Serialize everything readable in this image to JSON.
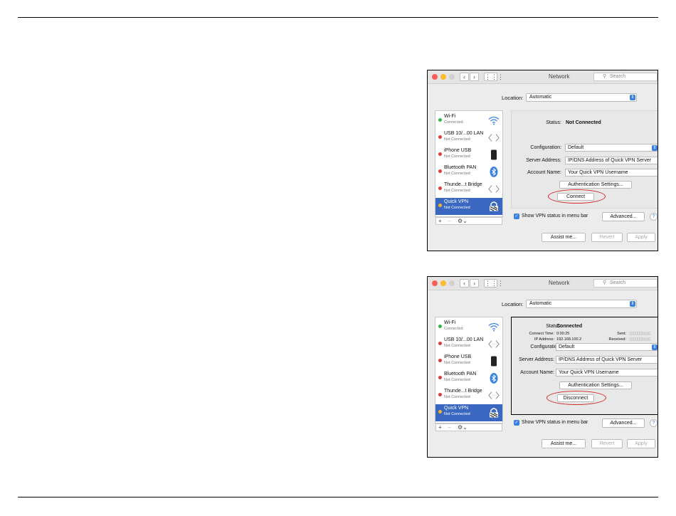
{
  "window_title": "Network",
  "search_placeholder": "Search",
  "location_label": "Location:",
  "location_value": "Automatic",
  "services": [
    {
      "name": "Wi-Fi",
      "status": "Connected",
      "dot": "#39b54a",
      "icon": "wifi-icon"
    },
    {
      "name": "USB 10/...00 LAN",
      "status": "Not Connected",
      "dot": "#e03b3b",
      "icon": "ethernet-icon"
    },
    {
      "name": "iPhone USB",
      "status": "Not Connected",
      "dot": "#e03b3b",
      "icon": "iphone-icon"
    },
    {
      "name": "Bluetooth PAN",
      "status": "Not Connected",
      "dot": "#e03b3b",
      "icon": "bluetooth-icon"
    },
    {
      "name": "Thunde...t Bridge",
      "status": "Not Connected",
      "dot": "#e03b3b",
      "icon": "bridge-icon"
    },
    {
      "name": "Quick VPN",
      "status": "Not Connected",
      "dot": "#f0b429",
      "icon": "vpn-lock-icon"
    }
  ],
  "sidebar_footer": {
    "add": "+",
    "remove": "−",
    "action": "⚙⌄"
  },
  "labels": {
    "status": "Status:",
    "connect_time": "Connect Time:",
    "ip_address": "IP Address:",
    "sent": "Sent:",
    "received": "Received:",
    "configuration": "Configuration:",
    "server_address": "Server Address:",
    "account_name": "Account Name:"
  },
  "values": {
    "configuration": "Default",
    "server_address": "IP/DNS Address of Quick VPN Server",
    "account_name": "Your Quick VPN Username"
  },
  "auth_button": "Authentication Settings...",
  "show_vpn_status": "Show VPN status in menu bar",
  "advanced_button": "Advanced...",
  "help": "?",
  "assist_button": "Assist me...",
  "revert_button": "Revert",
  "apply_button": "Apply",
  "window1": {
    "status": "Not Connected",
    "action_button": "Connect"
  },
  "window2": {
    "status": "Connected",
    "connect_time": "0:00:25",
    "ip_address": "192.168.100.2",
    "sent_meter": "▯▯▯▯▯▯▯▯▯▯",
    "received_meter": "▯▯▯▯▯▯▯▯▯▯",
    "action_button": "Disconnect"
  },
  "colors": {
    "accent": "#3b82e0",
    "selected": "#3a68c0",
    "highlight_oval": "#d62828"
  }
}
